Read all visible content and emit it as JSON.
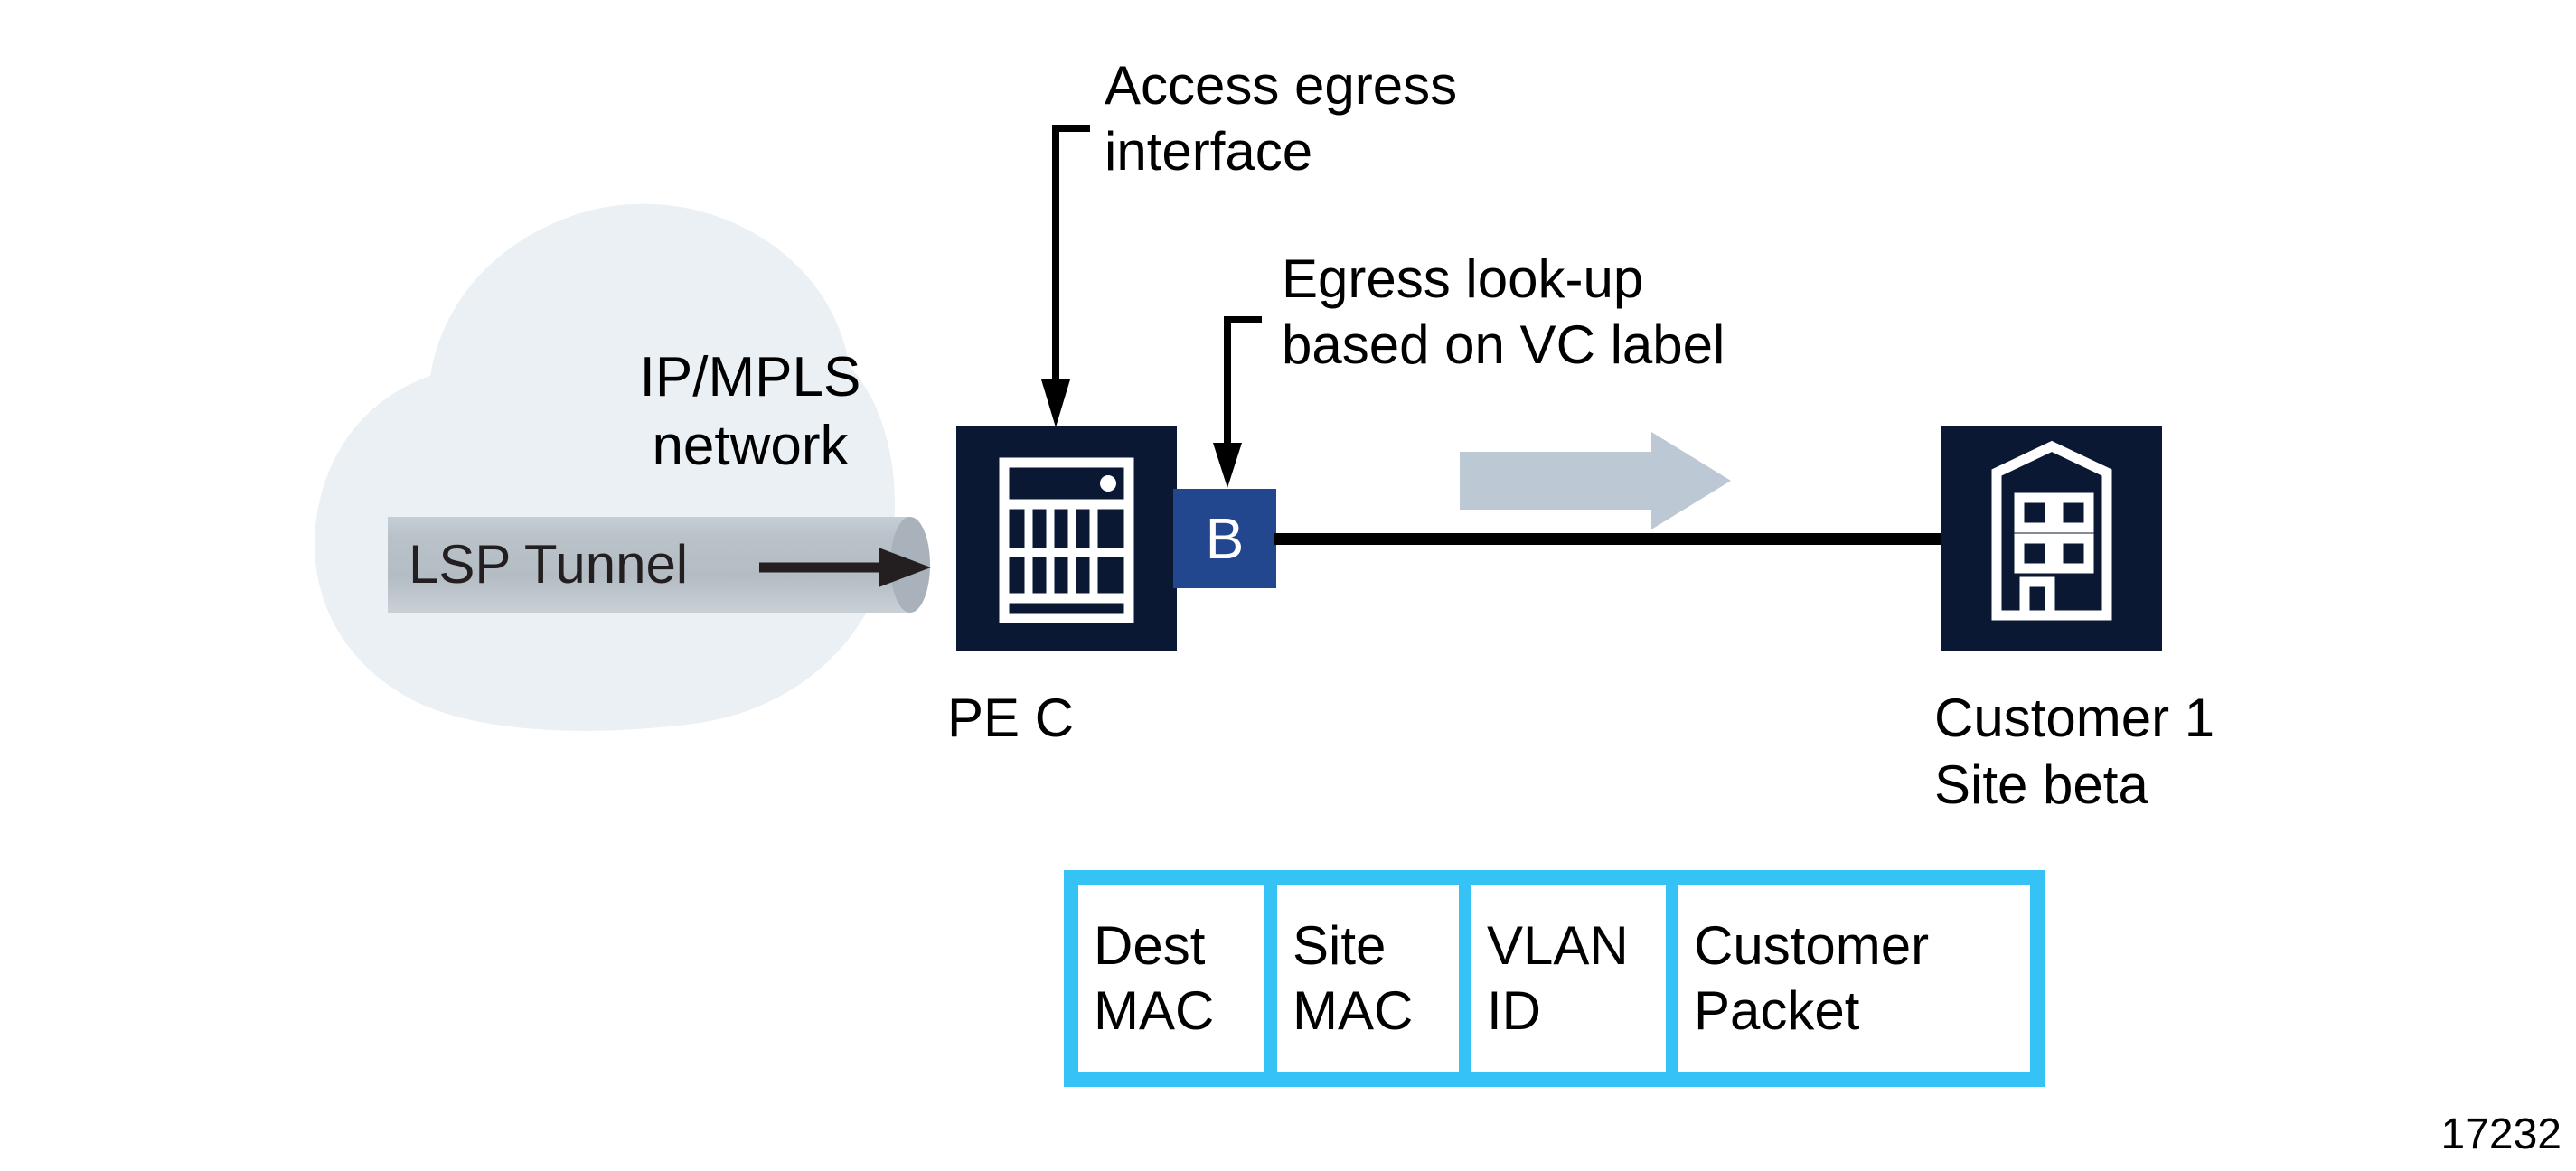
{
  "diagram": {
    "figure_id": "17232",
    "colors": {
      "cloud_fill": "#eaf0f4",
      "tunnel_fill": "#b8c0c8",
      "tunnel_cap": "#a7b0b8",
      "device_navy": "#0a1833",
      "vc_label_blue": "#22478f",
      "flow_arrow_gray": "#bcc8d4",
      "packet_table_cyan": "#35c2f5",
      "link_line_black": "#000000",
      "text_black": "#000000"
    },
    "cloud": {
      "label": "IP/MPLS\nnetwork"
    },
    "tunnel": {
      "label": "LSP Tunnel",
      "arrow_icon": "right-arrow-icon"
    },
    "nodes": [
      {
        "id": "pe-c",
        "label": "PE C",
        "icon": "router-chassis-icon"
      },
      {
        "id": "customer-1-site-beta",
        "label": "Customer 1\nSite beta",
        "icon": "building-icon"
      }
    ],
    "vc_label_box": {
      "text": "B"
    },
    "flow_arrow": {
      "icon": "block-arrow-right-icon"
    },
    "callouts": [
      {
        "id": "access-egress-interface",
        "text": "Access egress\ninterface",
        "leader_icon": "leader-arrow-down-icon"
      },
      {
        "id": "egress-lookup-vc-label",
        "text": "Egress look-up\nbased on VC label",
        "leader_icon": "leader-arrow-down-icon"
      }
    ],
    "packet_table": {
      "cells": [
        {
          "text": "Dest\nMAC"
        },
        {
          "text": "Site\nMAC"
        },
        {
          "text": "VLAN\nID"
        },
        {
          "text": "Customer\nPacket"
        }
      ]
    }
  }
}
